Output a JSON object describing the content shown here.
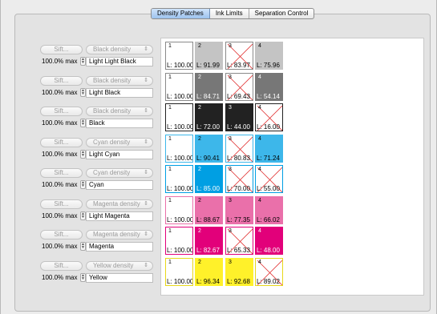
{
  "tabs": [
    {
      "label": "Density Patches",
      "active": true
    },
    {
      "label": "Ink Limits",
      "active": false
    },
    {
      "label": "Separation Control",
      "active": false
    }
  ],
  "colors": {
    "light_light_black": "#c4c4c4",
    "light_black": "#777777",
    "black": "#222222",
    "cyan": "#009fe3",
    "light_cyan": "#3db7ea",
    "magenta": "#e2007a",
    "light_magenta": "#ea70aa",
    "yellow": "#fff12a"
  },
  "channels": [
    {
      "sift": "Sift...",
      "density": "Black density",
      "max": "100.0% max",
      "name": "Light Light Black",
      "patches": [
        {
          "num": "1",
          "l": "L: 100.00",
          "fill": "#ffffff",
          "border": "#8a8a8a",
          "crossed": false,
          "dark": false
        },
        {
          "num": "2",
          "l": "L: 91.99",
          "fill": "#c4c4c4",
          "border": "#c4c4c4",
          "crossed": false,
          "dark": false
        },
        {
          "num": "3",
          "l": "L: 83.97",
          "fill": "#ffffff",
          "border": "#8a8a8a",
          "crossed": true,
          "dark": false
        },
        {
          "num": "4",
          "l": "L: 75.96",
          "fill": "#c4c4c4",
          "border": "#c4c4c4",
          "crossed": false,
          "dark": false
        }
      ]
    },
    {
      "sift": "Sift...",
      "density": "Black density",
      "max": "100.0% max",
      "name": "Light Black",
      "patches": [
        {
          "num": "1",
          "l": "L: 100.00",
          "fill": "#ffffff",
          "border": "#8a8a8a",
          "crossed": false,
          "dark": false
        },
        {
          "num": "2",
          "l": "L: 84.71",
          "fill": "#777777",
          "border": "#777777",
          "crossed": false,
          "dark": true
        },
        {
          "num": "3",
          "l": "L: 69.43",
          "fill": "#ffffff",
          "border": "#8a8a8a",
          "crossed": true,
          "dark": false
        },
        {
          "num": "4",
          "l": "L: 54.14",
          "fill": "#777777",
          "border": "#777777",
          "crossed": false,
          "dark": true
        }
      ]
    },
    {
      "sift": "Sift...",
      "density": "Black density",
      "max": "100.0% max",
      "name": "Black",
      "patches": [
        {
          "num": "1",
          "l": "L: 100.00",
          "fill": "#ffffff",
          "border": "#222222",
          "crossed": false,
          "dark": false
        },
        {
          "num": "2",
          "l": "L: 72.00",
          "fill": "#222222",
          "border": "#222222",
          "crossed": false,
          "dark": true
        },
        {
          "num": "3",
          "l": "L: 44.00",
          "fill": "#222222",
          "border": "#222222",
          "crossed": false,
          "dark": true
        },
        {
          "num": "4",
          "l": "L: 16.00",
          "fill": "#ffffff",
          "border": "#222222",
          "crossed": true,
          "dark": false
        }
      ]
    },
    {
      "sift": "Sift...",
      "density": "Cyan density",
      "max": "100.0% max",
      "name": "Light Cyan",
      "patches": [
        {
          "num": "1",
          "l": "L: 100.00",
          "fill": "#ffffff",
          "border": "#3db7ea",
          "crossed": false,
          "dark": false
        },
        {
          "num": "2",
          "l": "L: 90.41",
          "fill": "#3db7ea",
          "border": "#3db7ea",
          "crossed": false,
          "dark": false
        },
        {
          "num": "3",
          "l": "L: 80.83",
          "fill": "#ffffff",
          "border": "#3db7ea",
          "crossed": true,
          "dark": false
        },
        {
          "num": "4",
          "l": "L: 71.24",
          "fill": "#3db7ea",
          "border": "#3db7ea",
          "crossed": false,
          "dark": false
        }
      ]
    },
    {
      "sift": "Sift...",
      "density": "Cyan density",
      "max": "100.0% max",
      "name": "Cyan",
      "patches": [
        {
          "num": "1",
          "l": "L: 100.00",
          "fill": "#ffffff",
          "border": "#009fe3",
          "crossed": false,
          "dark": false
        },
        {
          "num": "2",
          "l": "L: 85.00",
          "fill": "#009fe3",
          "border": "#009fe3",
          "crossed": false,
          "dark": true
        },
        {
          "num": "3",
          "l": "L: 70.00",
          "fill": "#ffffff",
          "border": "#009fe3",
          "crossed": true,
          "dark": false
        },
        {
          "num": "4",
          "l": "L: 55.00",
          "fill": "#ffffff",
          "border": "#009fe3",
          "crossed": true,
          "dark": false
        }
      ]
    },
    {
      "sift": "Sift...",
      "density": "Magenta density",
      "max": "100.0% max",
      "name": "Light Magenta",
      "patches": [
        {
          "num": "1",
          "l": "L: 100.00",
          "fill": "#ffffff",
          "border": "#ea70aa",
          "crossed": false,
          "dark": false
        },
        {
          "num": "2",
          "l": "L: 88.67",
          "fill": "#ea70aa",
          "border": "#ea70aa",
          "crossed": false,
          "dark": false
        },
        {
          "num": "3",
          "l": "L: 77.35",
          "fill": "#ea70aa",
          "border": "#ea70aa",
          "crossed": false,
          "dark": false
        },
        {
          "num": "4",
          "l": "L: 66.02",
          "fill": "#ea70aa",
          "border": "#ea70aa",
          "crossed": false,
          "dark": false
        }
      ]
    },
    {
      "sift": "Sift...",
      "density": "Magenta density",
      "max": "100.0% max",
      "name": "Magenta",
      "patches": [
        {
          "num": "1",
          "l": "L: 100.00",
          "fill": "#ffffff",
          "border": "#e2007a",
          "crossed": false,
          "dark": false
        },
        {
          "num": "2",
          "l": "L: 82.67",
          "fill": "#e2007a",
          "border": "#e2007a",
          "crossed": false,
          "dark": true
        },
        {
          "num": "3",
          "l": "L: 65.33",
          "fill": "#ffffff",
          "border": "#e2007a",
          "crossed": true,
          "dark": false
        },
        {
          "num": "4",
          "l": "L: 48.00",
          "fill": "#e2007a",
          "border": "#e2007a",
          "crossed": false,
          "dark": true
        }
      ]
    },
    {
      "sift": "Sift...",
      "density": "Yellow density",
      "max": "100.0% max",
      "name": "Yellow",
      "patches": [
        {
          "num": "1",
          "l": "L: 100.00",
          "fill": "#ffffff",
          "border": "#e8d81a",
          "crossed": false,
          "dark": false
        },
        {
          "num": "2",
          "l": "L: 96.34",
          "fill": "#fff12a",
          "border": "#fff12a",
          "crossed": false,
          "dark": false
        },
        {
          "num": "3",
          "l": "L: 92.68",
          "fill": "#fff12a",
          "border": "#fff12a",
          "crossed": false,
          "dark": false
        },
        {
          "num": "4",
          "l": "L: 89.02",
          "fill": "#ffffff",
          "border": "#e8d81a",
          "crossed": true,
          "dark": false
        }
      ]
    }
  ]
}
